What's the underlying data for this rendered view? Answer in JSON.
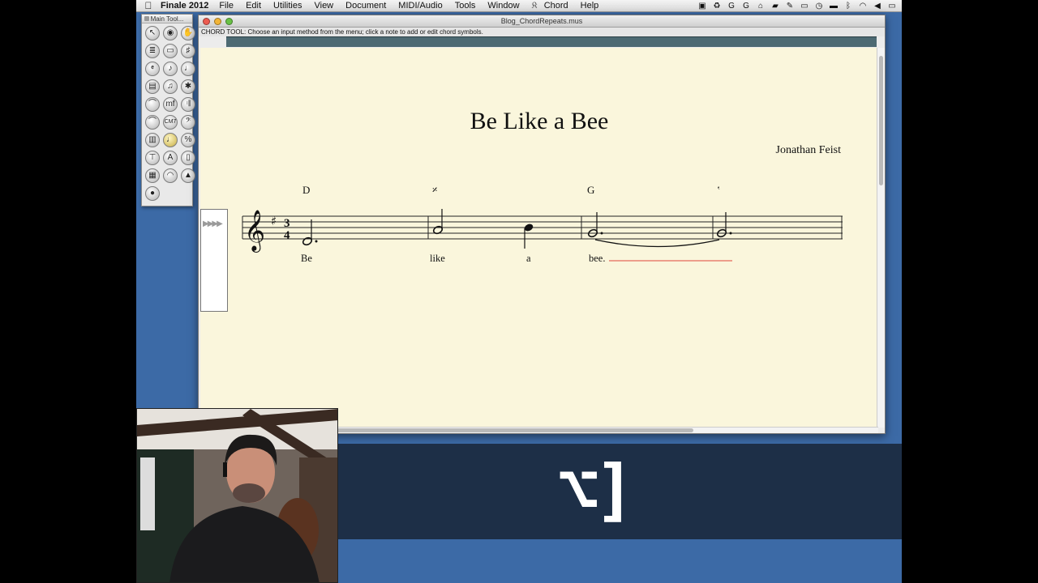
{
  "menubar": {
    "apple": "",
    "app_name": "Finale 2012",
    "items": [
      "File",
      "Edit",
      "Utilities",
      "View",
      "Document",
      "MIDI/Audio",
      "Tools",
      "Window",
      "Chord",
      "Help"
    ]
  },
  "palette": {
    "title": "Main Tool...",
    "tools": [
      {
        "icon": "selection-tool-icon",
        "glyph": "↖",
        "selected": false
      },
      {
        "icon": "zoom-tool-icon",
        "glyph": "◉",
        "selected": false
      },
      {
        "icon": "hand-grabber-icon",
        "glyph": "✋",
        "selected": false
      },
      {
        "icon": "staff-tool-icon",
        "glyph": "≣",
        "selected": false
      },
      {
        "icon": "measure-tool-icon",
        "glyph": "▭",
        "selected": false
      },
      {
        "icon": "key-signature-icon",
        "glyph": "♯",
        "selected": false
      },
      {
        "icon": "time-signature-icon",
        "glyph": "𝄵",
        "selected": false
      },
      {
        "icon": "clef-tool-icon",
        "glyph": "♪",
        "selected": false
      },
      {
        "icon": "speedy-entry-icon",
        "glyph": "♩",
        "selected": false
      },
      {
        "icon": "simple-entry-icon",
        "glyph": "▤",
        "selected": false
      },
      {
        "icon": "tuplet-tool-icon",
        "glyph": "♫",
        "selected": false
      },
      {
        "icon": "smart-shape-icon",
        "glyph": "✱",
        "selected": false
      },
      {
        "icon": "articulation-tool-icon",
        "glyph": "⌒",
        "selected": false
      },
      {
        "icon": "expression-tool-icon",
        "glyph": "mf",
        "selected": false
      },
      {
        "icon": "repeat-tool-icon",
        "glyph": "𝄇",
        "selected": false
      },
      {
        "icon": "lyrics-tool-icon",
        "glyph": "⌒",
        "selected": false
      },
      {
        "icon": "chord-tool-icon",
        "glyph": "CM7",
        "selected": false
      },
      {
        "icon": "fretboard-tool-icon",
        "glyph": "𝄢",
        "selected": false
      },
      {
        "icon": "graphics-tool-icon",
        "glyph": "▥",
        "selected": false
      },
      {
        "icon": "mirror-tool-icon",
        "glyph": "♩",
        "selected": true
      },
      {
        "icon": "percussion-icon",
        "glyph": "%",
        "selected": false
      },
      {
        "icon": "special-tools-icon",
        "glyph": "⊤",
        "selected": false
      },
      {
        "icon": "text-tool-icon",
        "glyph": "A",
        "selected": false
      },
      {
        "icon": "page-layout-icon",
        "glyph": "▯",
        "selected": false
      },
      {
        "icon": "note-mover-icon",
        "glyph": "▦",
        "selected": false
      },
      {
        "icon": "resize-tool-icon",
        "glyph": "◠",
        "selected": false
      },
      {
        "icon": "metronome-icon",
        "glyph": "▲",
        "selected": false
      },
      {
        "icon": "color-tool-icon",
        "glyph": "●",
        "selected": false
      }
    ]
  },
  "window": {
    "title": "Blog_ChordRepeats.mus",
    "status_message": "CHORD TOOL: Choose an input method from the menu; click a note to add or edit chord symbols."
  },
  "score": {
    "title": "Be Like a Bee",
    "composer": "Jonathan Feist",
    "time_signature": "3/4",
    "key": "G major (one sharp)",
    "chords": [
      "D",
      "𝄎",
      "G",
      "‛"
    ],
    "lyrics": [
      "Be",
      "like",
      "a",
      "bee."
    ]
  },
  "overlay": {
    "key_glyph": "⌥]"
  },
  "colors": {
    "desktop": "#3c6aa6",
    "page": "#faf6dc",
    "lyric_extender": "#e0453a",
    "ruler": "#4d6a73"
  }
}
